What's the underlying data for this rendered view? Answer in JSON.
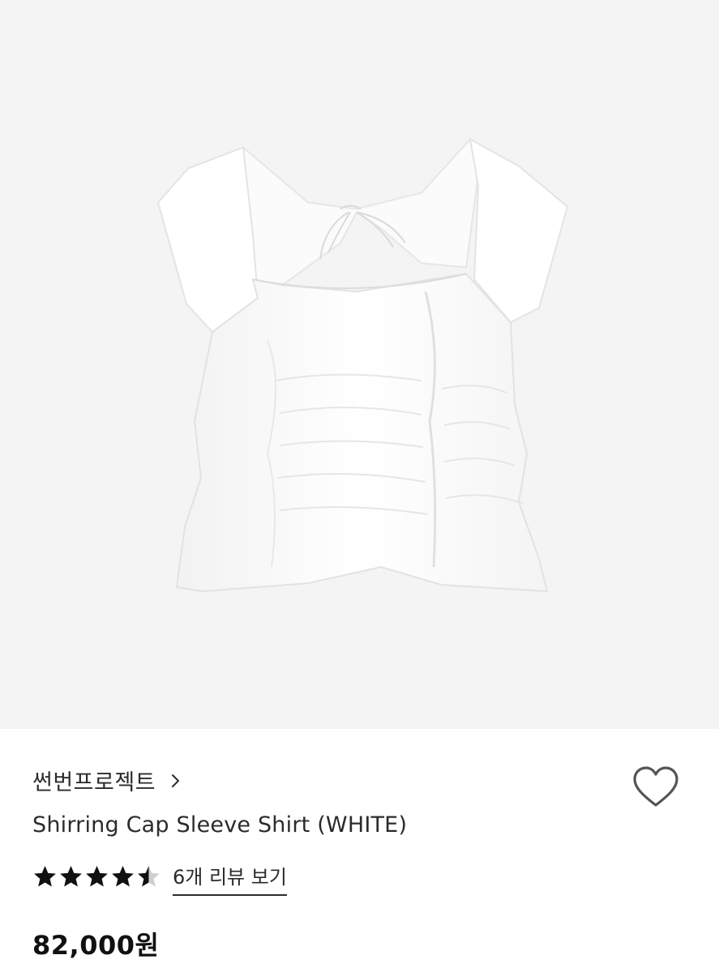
{
  "product": {
    "image_icon": "white-shirred-cap-sleeve-top-photo",
    "brand": "썬번프로젝트",
    "brand_chevron_icon": "chevron-right-icon",
    "name": "Shirring Cap Sleeve Shirt (WHITE)",
    "wishlist_icon": "heart-outline-icon",
    "rating": 4.5,
    "rating_max": 5,
    "review_link": "6개 리뷰 보기",
    "price": "82,000원"
  },
  "colors": {
    "image_background": "#f4f4f4",
    "text": "#2b2b2b",
    "star_filled": "#111111",
    "star_empty": "#cfcfcf",
    "heart_stroke": "#555555"
  }
}
